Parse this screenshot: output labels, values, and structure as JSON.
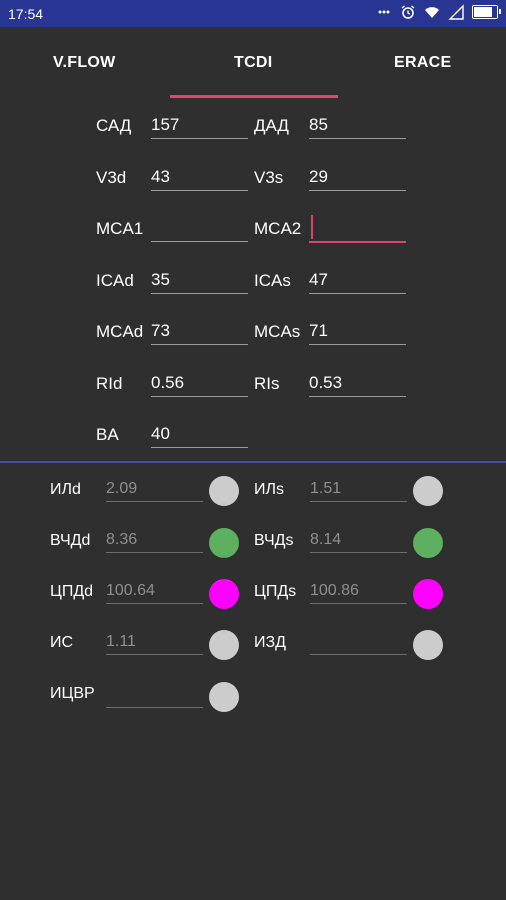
{
  "status_bar": {
    "time": "17:54"
  },
  "tabs": [
    {
      "label": "V.FLOW"
    },
    {
      "label": "TCDI"
    },
    {
      "label": "ERACE"
    }
  ],
  "active_tab": "TCDI",
  "form": {
    "sad": {
      "label": "САД",
      "value": "157"
    },
    "dad": {
      "label": "ДАД",
      "value": "85"
    },
    "v3d": {
      "label": "V3d",
      "value": "43"
    },
    "v3s": {
      "label": "V3s",
      "value": "29"
    },
    "mca1": {
      "label": "MCA1",
      "value": ""
    },
    "mca2": {
      "label": "MCA2",
      "value": ""
    },
    "icad": {
      "label": "ICAd",
      "value": "35"
    },
    "icas": {
      "label": "ICAs",
      "value": "47"
    },
    "mcad": {
      "label": "MCAd",
      "value": "73"
    },
    "mcas": {
      "label": "MCAs",
      "value": "71"
    },
    "rid": {
      "label": "RId",
      "value": "0.56"
    },
    "ris": {
      "label": "RIs",
      "value": "0.53"
    },
    "ba": {
      "label": "BA",
      "value": "40"
    }
  },
  "results": {
    "ild": {
      "label": "ИЛd",
      "value": "2.09",
      "indicator_color": "#cccccc"
    },
    "ils": {
      "label": "ИЛs",
      "value": "1.51",
      "indicator_color": "#cccccc"
    },
    "vchdd": {
      "label": "ВЧДd",
      "value": "8.36",
      "indicator_color": "#5cb060"
    },
    "vchds": {
      "label": "ВЧДs",
      "value": "8.14",
      "indicator_color": "#5cb060"
    },
    "cpdd": {
      "label": "ЦПДd",
      "value": "100.64",
      "indicator_color": "#ff00ff"
    },
    "cpds": {
      "label": "ЦПДs",
      "value": "100.86",
      "indicator_color": "#ff00ff"
    },
    "is": {
      "label": "ИС",
      "value": "1.11",
      "indicator_color": "#cccccc"
    },
    "izd": {
      "label": "ИЗД",
      "value": "",
      "indicator_color": "#cccccc"
    },
    "icvr": {
      "label": "ИЦВР",
      "value": "",
      "indicator_color": "#cccccc"
    }
  }
}
